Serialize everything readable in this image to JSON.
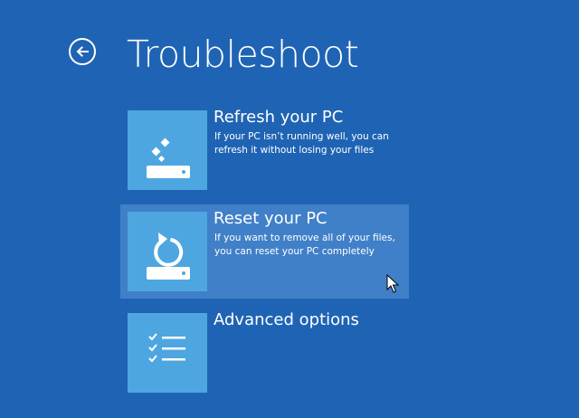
{
  "header": {
    "title": "Troubleshoot",
    "back_icon": "back-arrow-icon"
  },
  "options": [
    {
      "title": "Refresh your PC",
      "description": "If your PC isn’t running well, you can refresh it without losing your files",
      "icon": "refresh-pc-icon",
      "selected": false
    },
    {
      "title": "Reset your PC",
      "description": "If you want to remove all of your files, you can reset your PC completely",
      "icon": "reset-pc-icon",
      "selected": true
    },
    {
      "title": "Advanced options",
      "description": "",
      "icon": "advanced-options-icon",
      "selected": false
    }
  ],
  "colors": {
    "background": "#1f64b4",
    "tile": "#4ea6e0",
    "selected_highlight": "#4080c8",
    "text": "#ffffff"
  }
}
